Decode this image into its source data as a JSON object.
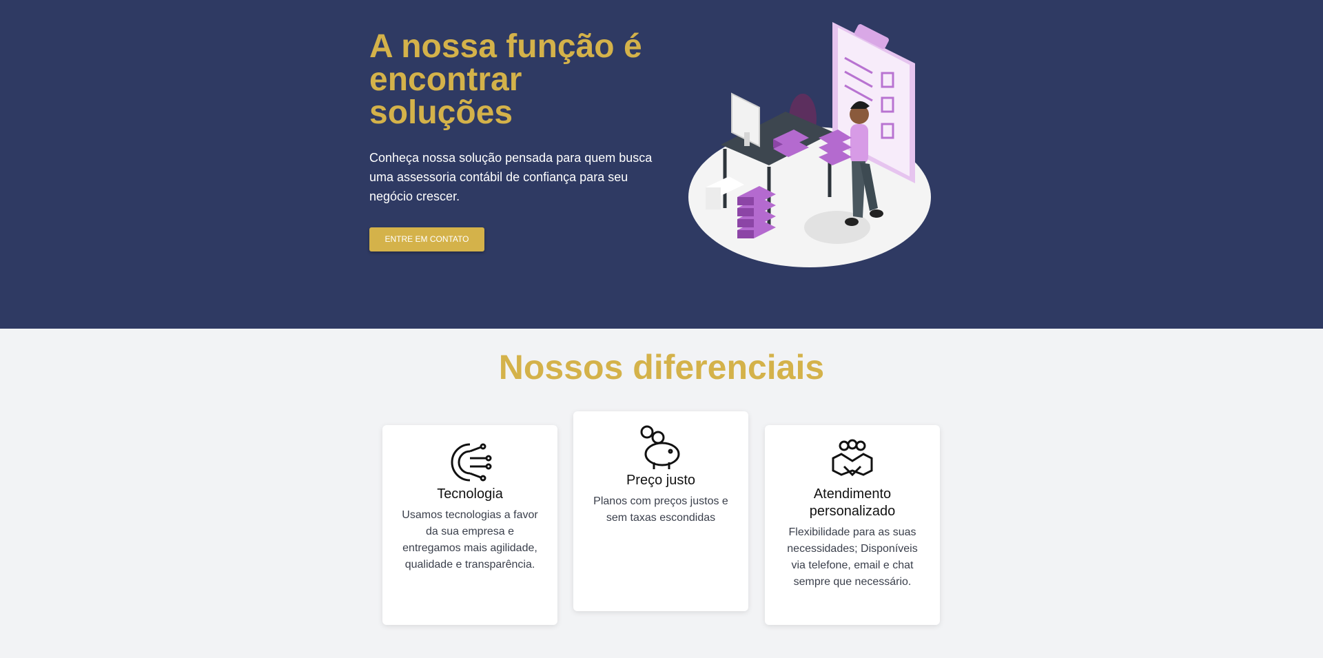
{
  "hero": {
    "title": "A nossa função é encontrar soluções",
    "subtitle": "Conheça nossa solução pensada para quem busca uma assessoria contábil de confiança para seu negócio crescer.",
    "cta_label": "ENTRE EM CONTATO"
  },
  "features": {
    "title": "Nossos diferenciais",
    "cards": [
      {
        "icon": "technology-gear-icon",
        "title": "Tecnologia",
        "text": "Usamos tecnologias a favor da sua empresa e entregamos mais agilidade, qualidade e transparência."
      },
      {
        "icon": "piggy-bank-icon",
        "title": "Preço justo",
        "text": "Planos com preços justos e sem taxas escondidas"
      },
      {
        "icon": "handshake-icon",
        "title": "Atendimento personalizado",
        "text": "Flexibilidade para as suas necessidades; Disponíveis via telefone, email e chat sempre que necessário."
      }
    ]
  },
  "colors": {
    "hero_bg": "#2f3a63",
    "accent": "#d4b24a",
    "page_bg": "#f2f3f5",
    "illustration_purple": "#a35fc4"
  }
}
